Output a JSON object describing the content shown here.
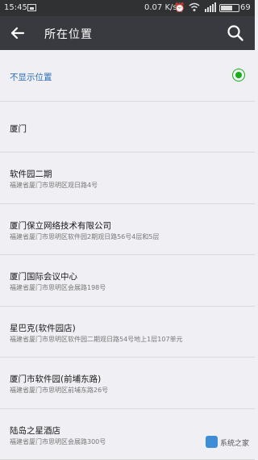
{
  "status_bar": {
    "time": "15:45",
    "speed": "0.07 K/s",
    "battery": "69",
    "battery_level": 0.69,
    "icons": [
      "photo-icon",
      "alarm-icon",
      "wifi-icon",
      "signal-icon",
      "battery-icon"
    ]
  },
  "header": {
    "title": "所在位置",
    "back_icon": "back-arrow-icon",
    "search_icon": "search-icon"
  },
  "locations": [
    {
      "name": "不显示位置",
      "address": "",
      "selected": true
    },
    {
      "name": "厦门",
      "address": "",
      "selected": false
    },
    {
      "name": "软件园二期",
      "address": "福建省厦门市思明区观日路4号",
      "selected": false
    },
    {
      "name": "厦门保立网络技术有限公司",
      "address": "福建省厦门市思明区软件园2期观日路56号4层和5层",
      "selected": false
    },
    {
      "name": "厦门国际会议中心",
      "address": "福建省厦门市思明区会展路198号",
      "selected": false
    },
    {
      "name": "星巴克(软件园店)",
      "address": "福建省厦门市思明区软件园二期观日路54号地上1层107单元",
      "selected": false
    },
    {
      "name": "厦门市软件园(前埔东路)",
      "address": "福建省厦门市思明区前埔东路26号",
      "selected": false
    },
    {
      "name": "陆岛之星酒店",
      "address": "福建省厦门市思明区会展路300号",
      "selected": false
    }
  ],
  "watermark": {
    "text": "系统之家"
  },
  "colors": {
    "header_bg": "#393a3f",
    "status_bg": "#2f3133",
    "accent_green": "#1aad19",
    "hidden_location_text": "#2b6fb5",
    "list_bg": "#efeff4"
  }
}
